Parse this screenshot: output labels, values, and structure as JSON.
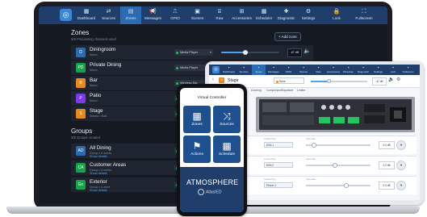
{
  "laptop": {
    "nav": [
      {
        "label": "Dashboard",
        "icon": "grid-icon"
      },
      {
        "label": "Sources",
        "icon": "sources-icon"
      },
      {
        "label": "Zones",
        "icon": "zones-icon",
        "active": true
      },
      {
        "label": "Messages",
        "icon": "megaphone-icon"
      },
      {
        "label": "GPIO",
        "icon": "gpio-icon"
      },
      {
        "label": "Scenes",
        "icon": "scenes-icon"
      },
      {
        "label": "Raw",
        "icon": "raw-icon"
      },
      {
        "label": "Accessories",
        "icon": "accessories-icon"
      },
      {
        "label": "Scheduler",
        "icon": "calendar-icon"
      },
      {
        "label": "Diagnostic",
        "icon": "diagnostic-icon"
      },
      {
        "label": "Settings",
        "icon": "gear-icon"
      },
      {
        "label": "Lock",
        "icon": "lock-icon"
      },
      {
        "label": "Fullscreen",
        "icon": "fullscreen-icon"
      }
    ],
    "zones_title": "Zones",
    "zones_sub": "5/8 Processing channels used",
    "add_zone": "+ Add zone",
    "zones": [
      {
        "name": "Diningroom",
        "sub": "Mono",
        "icon": "D",
        "color": "#2b6cb0",
        "source": "Media Player",
        "volume": 0.42,
        "db": "-67 dB"
      },
      {
        "name": "Private Dining",
        "sub": "Mono",
        "icon": "PD",
        "color": "#16a34a",
        "source": "Media Player",
        "volume": 0.28,
        "db": "-69 dB"
      },
      {
        "name": "Bar",
        "sub": "Mono",
        "icon": "B",
        "color": "#ea8a1c",
        "source": "Wireless Mic",
        "volume": 0.35,
        "db": "-58 dB"
      },
      {
        "name": "Patio",
        "sub": "Mono",
        "icon": "P",
        "color": "#7c3aed",
        "source": "Drive TV",
        "volume": 0.52,
        "db": "-55 dB"
      },
      {
        "name": "Stage",
        "sub": "Stereo • Sub",
        "icon": "S",
        "color": "#ea8a1c",
        "source": "Phone Mixer",
        "volume": 0.48,
        "db": "-62 dB"
      }
    ],
    "groups_title": "Groups",
    "groups_sub": "3/8 Groups created",
    "groups": [
      {
        "name": "All Dining",
        "sub": "Group • 2 zones",
        "link": "Show details",
        "icon": "AD",
        "color": "#2b6cb0",
        "source": "Media Player"
      },
      {
        "name": "Customer Areas",
        "sub": "Group • 3 zones",
        "link": "Show details",
        "icon": "CA",
        "color": "#16a34a",
        "source": "Media Player"
      },
      {
        "name": "Exterior",
        "sub": "Group • 1 zone",
        "link": "Show details",
        "icon": "Ex",
        "color": "#16a34a",
        "source": "Drive TV"
      }
    ]
  },
  "tablet": {
    "nav": [
      {
        "label": "Dashboard"
      },
      {
        "label": "Sources"
      },
      {
        "label": "Zones",
        "active": true
      },
      {
        "label": "Messages"
      },
      {
        "label": "GPIO"
      },
      {
        "label": "Scenes"
      },
      {
        "label": "Raw"
      },
      {
        "label": "Accessories"
      },
      {
        "label": "Scheduler"
      },
      {
        "label": "Diagnostic"
      },
      {
        "label": "Settings"
      },
      {
        "label": "Lock"
      },
      {
        "label": "Fullscreen"
      }
    ],
    "zone_title": "Stage",
    "source": "None",
    "db": "-47 dB",
    "tabs": [
      "Ducking",
      "Compressor",
      "Equalizer",
      "Limiter"
    ],
    "rows": [
      {
        "label": "Output",
        "dropdown": "DSA 1",
        "small_a": "Control Type",
        "small_b": "Input Gain",
        "knob": 0.12,
        "value": "0.0 dB"
      },
      {
        "label": "Input",
        "dropdown": "DSA 2",
        "small_a": "Control Type",
        "small_b": "Input Gain",
        "knob": 0.45,
        "value": "0.0 dB"
      },
      {
        "label": "Output",
        "dropdown": "Phone 1",
        "small_a": "Control Type",
        "small_b": "Input Gain",
        "knob": 0.62,
        "value": "0.0 dB"
      }
    ]
  },
  "phone": {
    "title": "Virtual Controller",
    "tiles": [
      {
        "label": "Zones",
        "icon": "zones-grid-icon"
      },
      {
        "label": "Sources",
        "icon": "sources-arrows-icon"
      },
      {
        "label": "Actions",
        "icon": "actions-icon"
      },
      {
        "label": "Schedule",
        "icon": "schedule-icon"
      }
    ],
    "brand": "ATMOSPHERE",
    "sub_brand": "AtlasIED"
  }
}
